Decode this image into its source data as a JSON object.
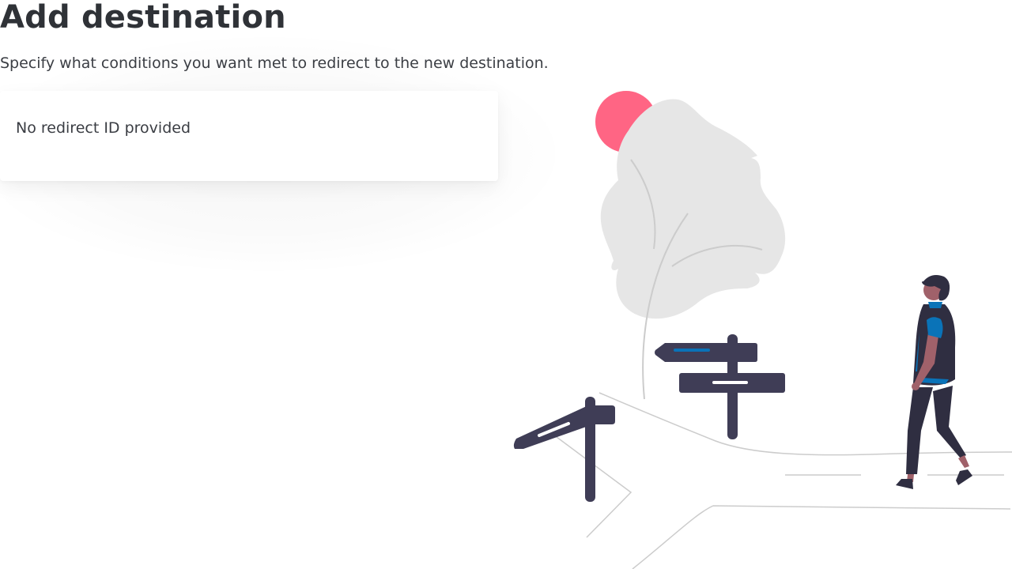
{
  "page": {
    "title": "Add destination",
    "subtitle": "Specify what conditions you want met to redirect to the new destination."
  },
  "card": {
    "message": "No redirect ID provided"
  },
  "illustration": {
    "name": "crossroads-illustration",
    "colors": {
      "sun": "#ff6584",
      "tree": "#e6e6e6",
      "signpost": "#3f3d56",
      "accent": "#0a73b8",
      "skin": "#a0616a",
      "clothing": "#2f2e41",
      "road_lines": "#cccccc"
    }
  }
}
